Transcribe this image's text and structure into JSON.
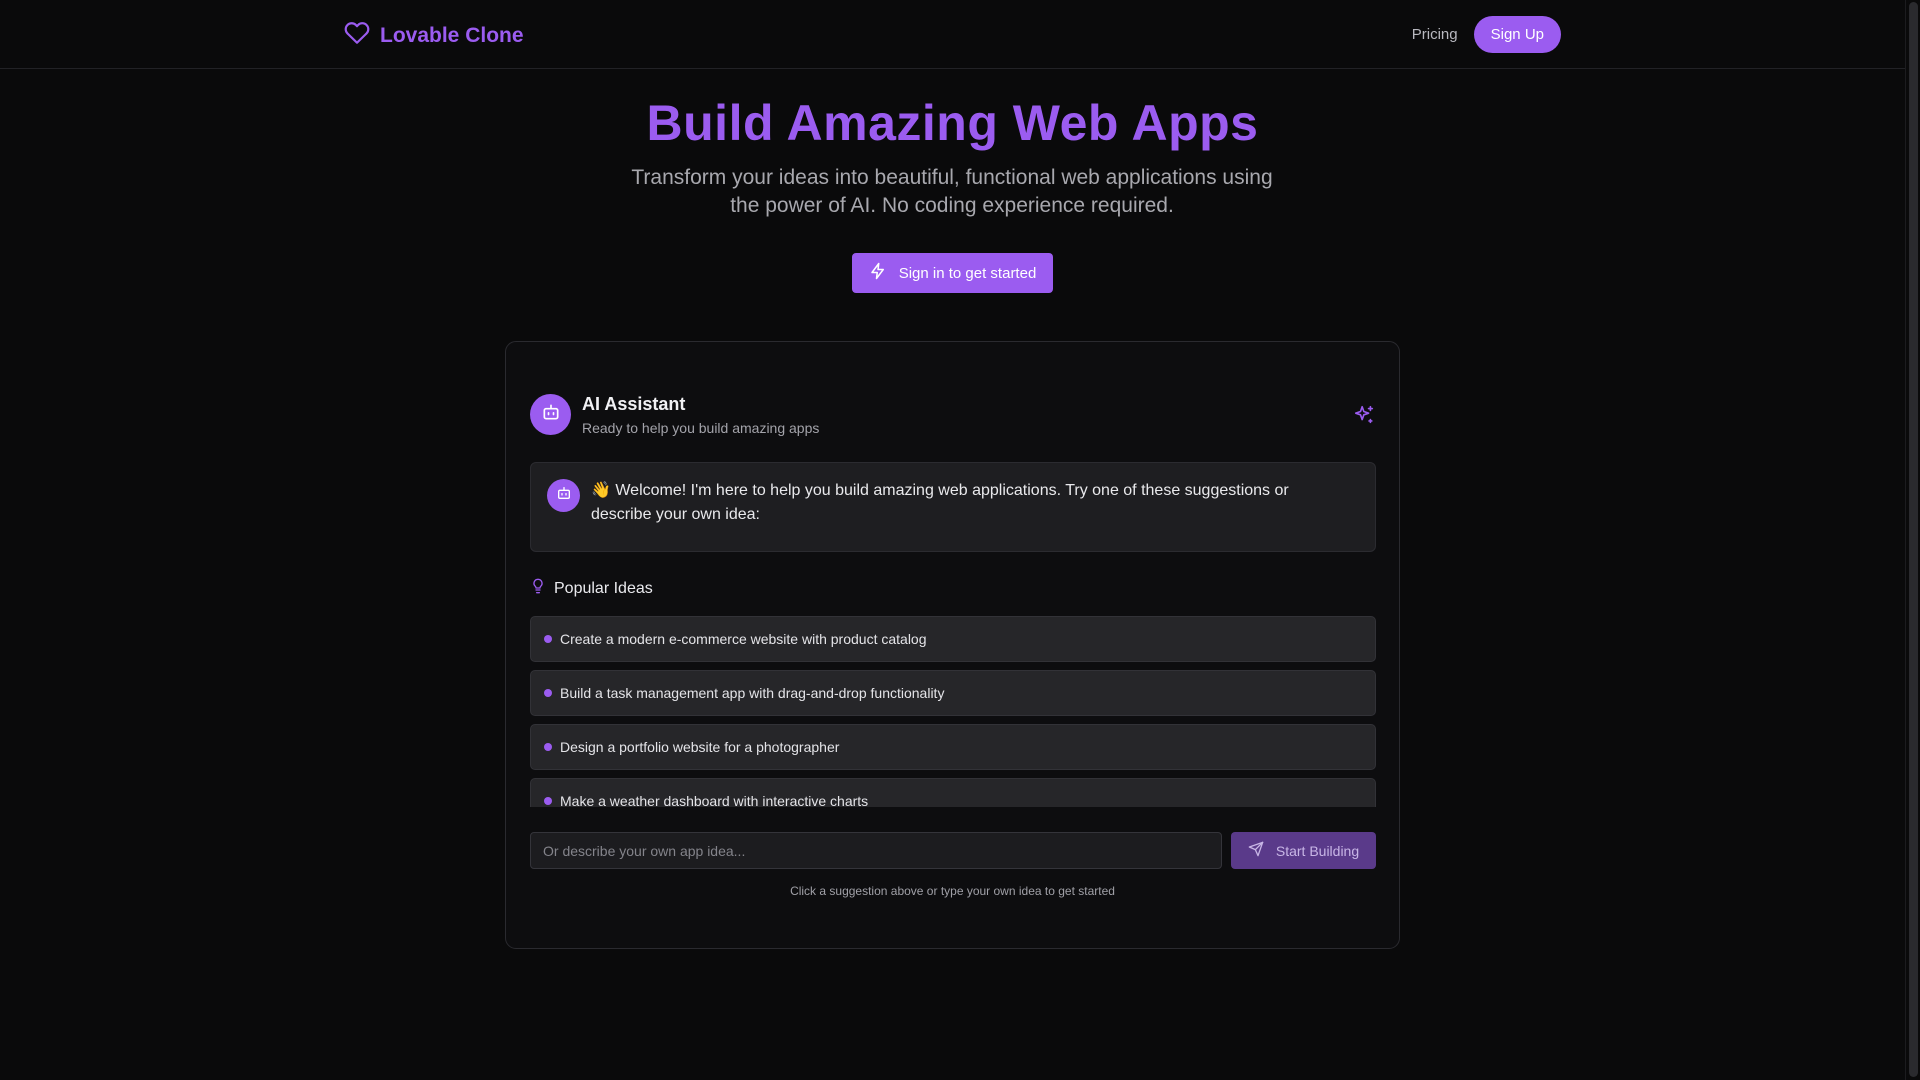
{
  "header": {
    "logo_text": "Lovable Clone",
    "logo_icon": "heart-icon",
    "nav": {
      "pricing_label": "Pricing",
      "signup_label": "Sign Up"
    }
  },
  "hero": {
    "title": "Build Amazing Web Apps",
    "subtitle": "Transform your ideas into beautiful, functional web applications using the power of AI. No coding experience required.",
    "cta_label": "Sign in to get started",
    "cta_icon": "lightning-icon"
  },
  "assistant": {
    "name": "AI Assistant",
    "status": "Ready to help you build amazing apps",
    "avatar_icon": "bot-icon",
    "corner_icon": "sparkles-icon",
    "welcome_message": "👋 Welcome! I'm here to help you build amazing web applications. Try one of these suggestions or describe your own idea:"
  },
  "ideas": {
    "header_label": "Popular Ideas",
    "header_icon": "lightbulb-icon",
    "items": [
      {
        "label": "Create a modern e-commerce website with product catalog"
      },
      {
        "label": "Build a task management app with drag-and-drop functionality"
      },
      {
        "label": "Design a portfolio website for a photographer"
      },
      {
        "label": "Make a weather dashboard with interactive charts"
      }
    ]
  },
  "composer": {
    "input_value": "",
    "input_placeholder": "Or describe your own app idea...",
    "submit_label": "Start Building",
    "submit_icon": "send-icon",
    "hint": "Click a suggestion above or type your own idea to get started"
  },
  "colors": {
    "accent": "#9b5cf0",
    "background": "#0a0a0b",
    "card_background": "#0d0d0f",
    "item_background": "#262629",
    "submit_disabled": "#5a3a8a"
  }
}
